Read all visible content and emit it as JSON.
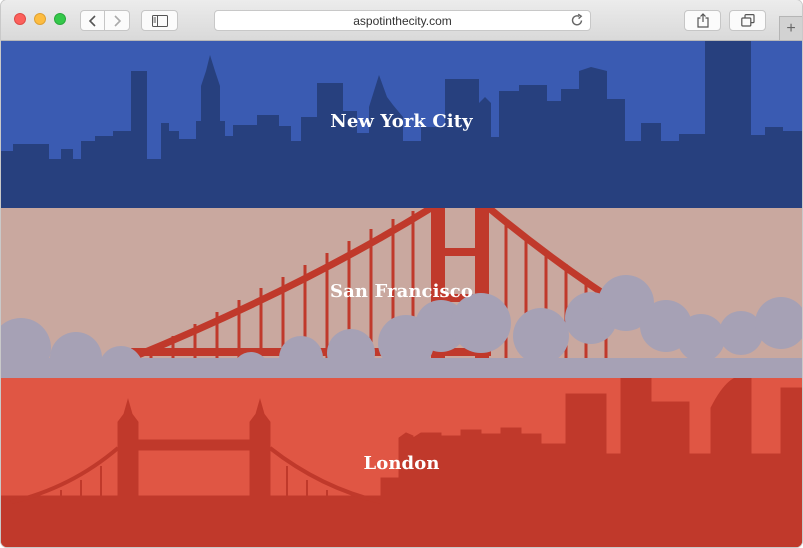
{
  "browser": {
    "url": "aspotinthecity.com",
    "icons": [
      "close-icon",
      "minimize-icon",
      "zoom-icon",
      "back-icon",
      "forward-icon",
      "sidebar-icon",
      "reload-icon",
      "share-icon",
      "tabs-overview-icon",
      "new-tab-icon"
    ]
  },
  "cities": [
    {
      "name": "New York City",
      "bg_color": "#3a5bb2",
      "skyline_color": "#27407e"
    },
    {
      "name": "San Francisco",
      "bg_color": "#c9a89f",
      "bridge_color": "#c0392b",
      "cloud_color": "#a6a1b5"
    },
    {
      "name": "London",
      "bg_color": "#e05644",
      "skyline_color": "#c0392b"
    }
  ]
}
